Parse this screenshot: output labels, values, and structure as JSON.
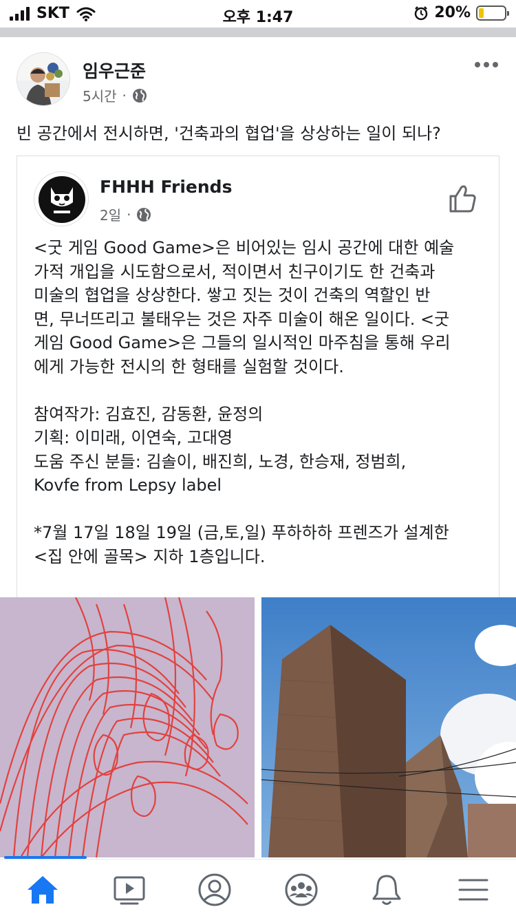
{
  "status_bar": {
    "carrier": "SKT",
    "time": "오후 1:47",
    "battery": "20%",
    "battery_level": 0.2,
    "icons": [
      "signal-icon",
      "wifi-icon",
      "alarm-icon",
      "battery-icon"
    ]
  },
  "post": {
    "author": "임우근준",
    "time": "5시간",
    "separator": "·",
    "text": "빈 공간에서 전시하면, '건축과의 협업'을 상상하는 일이 되나?",
    "icons": [
      "globe-icon",
      "more-icon"
    ]
  },
  "shared_post": {
    "author": "FHHH Friends",
    "time": "2일",
    "separator": "·",
    "body_lines": [
      "<굿 게임 Good Game>은 비어있는 임시 공간에 대한 예술",
      "가적 개입을 시도함으로서, 적이면서 친구이기도 한 건축과",
      "미술의 협업을 상상한다. 쌓고 짓는 것이 건축의 역할인 반",
      "면, 무너뜨리고 불태우는 것은 자주 미술이 해온 일이다. <굿",
      "게임 Good Game>은 그들의 일시적인 마주침을 통해 우리",
      "에게 가능한 전시의 한 형태를 실험할 것이다.",
      "참여작가: 김효진, 감동환, 윤정의",
      "기획: 이미래, 이연숙, 고대영",
      "도움 주신 분들: 김솔이, 배진희, 노경, 한승재, 정범희,",
      "Kovfe from Lepsy label",
      "*7월 17일 18일 19일 (금,토,일) 푸하하하 프렌즈가 설계한",
      "<집 안에 골목> 지하 1층입니다."
    ],
    "icons": [
      "globe-icon",
      "like-icon"
    ]
  },
  "photos": [
    "red-line-drawing-photo",
    "brick-building-photo"
  ],
  "photo_progress": 0.16,
  "tab_bar": {
    "tabs": [
      "home-icon",
      "video-icon",
      "profile-icon",
      "groups-icon",
      "notifications-icon",
      "menu-icon"
    ],
    "active": "home-icon"
  },
  "colors": {
    "accent": "#1877f2",
    "text": "#1c1e21",
    "secondary_text": "#65676b",
    "inactive_icon": "#606770"
  }
}
